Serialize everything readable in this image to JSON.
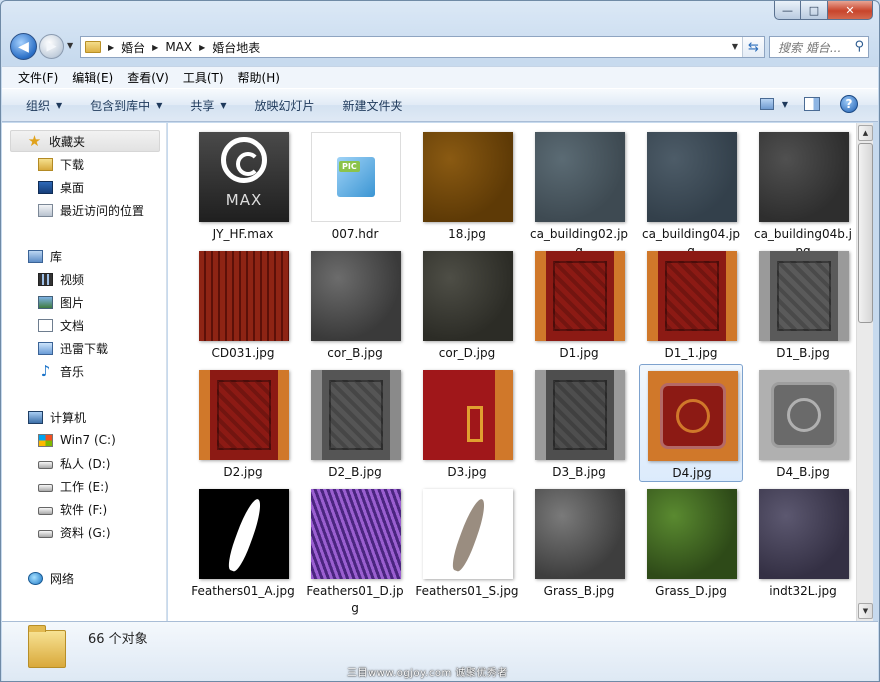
{
  "window": {
    "caption": {
      "min": "—",
      "max": "□",
      "close": "✕"
    }
  },
  "address": {
    "crumbs": [
      "婚台",
      "MAX",
      "婚台地表"
    ]
  },
  "search": {
    "placeholder": "搜索 婚台..."
  },
  "menu": [
    "文件(F)",
    "编辑(E)",
    "查看(V)",
    "工具(T)",
    "帮助(H)"
  ],
  "toolbar": {
    "organize": "组织",
    "include": "包含到库中",
    "share": "共享",
    "slideshow": "放映幻灯片",
    "new_folder": "新建文件夹"
  },
  "nav": {
    "favorites": "收藏夹",
    "downloads": "下载",
    "desktop": "桌面",
    "recent": "最近访问的位置",
    "libraries": "库",
    "videos": "视频",
    "pictures": "图片",
    "documents": "文档",
    "thunder": "迅雷下载",
    "music": "音乐",
    "computer": "计算机",
    "drives": [
      "Win7 (C:)",
      "私人 (D:)",
      "工作 (E:)",
      "软件 (F:)",
      "资料 (G:)"
    ],
    "network": "网络"
  },
  "files": [
    {
      "name": "JY_HF.max",
      "kind": "max"
    },
    {
      "name": "007.hdr",
      "kind": "hdr"
    },
    {
      "name": "18.jpg",
      "kind": "tex",
      "colors": [
        "#8a5a12",
        "#5e3a06"
      ]
    },
    {
      "name": "ca_building02.jpg",
      "kind": "tex",
      "colors": [
        "#5b6b74",
        "#3e4a52"
      ]
    },
    {
      "name": "ca_building04.jpg",
      "kind": "tex",
      "colors": [
        "#4d5c68",
        "#33404b"
      ]
    },
    {
      "name": "ca_building04b.jpg",
      "kind": "tex",
      "colors": [
        "#505050",
        "#2e2e2e"
      ]
    },
    {
      "name": "CD031.jpg",
      "kind": "wood",
      "colors": [
        "#8e2414",
        "#5c1008"
      ]
    },
    {
      "name": "cor_B.jpg",
      "kind": "tex",
      "colors": [
        "#6c6c6c",
        "#3a3a3a"
      ]
    },
    {
      "name": "cor_D.jpg",
      "kind": "tex",
      "colors": [
        "#4e4e46",
        "#2c2c26"
      ]
    },
    {
      "name": "D1.jpg",
      "kind": "carpet",
      "colors": [
        "#d0782a",
        "#8c1a14"
      ]
    },
    {
      "name": "D1_1.jpg",
      "kind": "carpet",
      "colors": [
        "#d0782a",
        "#8c1a14"
      ]
    },
    {
      "name": "D1_B.jpg",
      "kind": "carpet",
      "colors": [
        "#9a9a9a",
        "#5a5a5a"
      ]
    },
    {
      "name": "D2.jpg",
      "kind": "carpet",
      "colors": [
        "#d0782a",
        "#8c1a14"
      ]
    },
    {
      "name": "D2_B.jpg",
      "kind": "carpet",
      "colors": [
        "#8a8a8a",
        "#555555"
      ]
    },
    {
      "name": "D3.jpg",
      "kind": "carpet3",
      "colors": [
        "#d0782a",
        "#a0171a"
      ]
    },
    {
      "name": "D3_B.jpg",
      "kind": "carpet",
      "colors": [
        "#9a9a9a",
        "#4e4e4e"
      ]
    },
    {
      "name": "D4.jpg",
      "kind": "emblem",
      "colors": [
        "#d0782a",
        "#8c1a14"
      ]
    },
    {
      "name": "D4_B.jpg",
      "kind": "emblem",
      "colors": [
        "#b0b0b0",
        "#6a6a6a"
      ]
    },
    {
      "name": "Feathers01_A.jpg",
      "kind": "feather",
      "colors": [
        "#000000",
        "#ffffff"
      ]
    },
    {
      "name": "Feathers01_D.jpg",
      "kind": "hair",
      "colors": [
        "#9a5fd0",
        "#4b2580"
      ]
    },
    {
      "name": "Feathers01_S.jpg",
      "kind": "feather",
      "colors": [
        "#ffffff",
        "#9a8d80"
      ]
    },
    {
      "name": "Grass_B.jpg",
      "kind": "tex",
      "colors": [
        "#7a7a7a",
        "#3e3e3e"
      ]
    },
    {
      "name": "Grass_D.jpg",
      "kind": "tex",
      "colors": [
        "#5a8a30",
        "#2e4a18"
      ]
    },
    {
      "name": "indt32L.jpg",
      "kind": "tex",
      "colors": [
        "#5c5870",
        "#343044"
      ]
    }
  ],
  "selected_file": "D4.jpg",
  "status": {
    "count": "66 个对象",
    "watermark": "三目www.ogjoy.com 诚聚优秀者"
  }
}
